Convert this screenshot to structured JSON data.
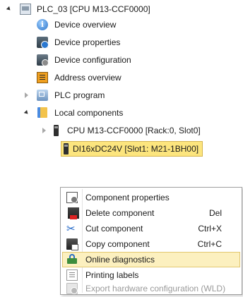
{
  "tree": {
    "root": {
      "label": "PLC_03 [CPU M13-CCF0000]",
      "icon": "plc-device-icon"
    },
    "items": [
      {
        "label": "Device overview",
        "icon": "info-icon"
      },
      {
        "label": "Device properties",
        "icon": "device-properties-icon"
      },
      {
        "label": "Device configuration",
        "icon": "device-configuration-icon"
      },
      {
        "label": "Address overview",
        "icon": "address-overview-icon"
      },
      {
        "label": "PLC program",
        "icon": "plc-program-icon"
      },
      {
        "label": "Local components",
        "icon": "folder-icon"
      }
    ],
    "components": [
      {
        "label": "CPU M13-CCF0000 [Rack:0, Slot0]",
        "icon": "module-icon"
      },
      {
        "label": "DI16xDC24V [Slot1: M21-1BH00]",
        "icon": "module-icon",
        "selected": true
      }
    ]
  },
  "context_menu": {
    "items": [
      {
        "label": "Component properties",
        "shortcut": "",
        "icon": "properties-icon"
      },
      {
        "label": "Delete component",
        "shortcut": "Del",
        "icon": "delete-icon"
      },
      {
        "label": "Cut component",
        "shortcut": "Ctrl+X",
        "icon": "cut-icon"
      },
      {
        "label": "Copy component",
        "shortcut": "Ctrl+C",
        "icon": "copy-icon"
      },
      {
        "label": "Online diagnostics",
        "shortcut": "",
        "icon": "diagnostics-icon",
        "highlighted": true
      },
      {
        "label": "Printing labels",
        "shortcut": "",
        "icon": "print-labels-icon"
      },
      {
        "label": "Export hardware configuration (WLD)",
        "shortcut": "",
        "icon": "export-icon",
        "disabled": true
      }
    ]
  },
  "colors": {
    "selection": "#fce57e",
    "menu_hover": "#fcf0bf",
    "disabled_text": "#9a9a9a"
  }
}
